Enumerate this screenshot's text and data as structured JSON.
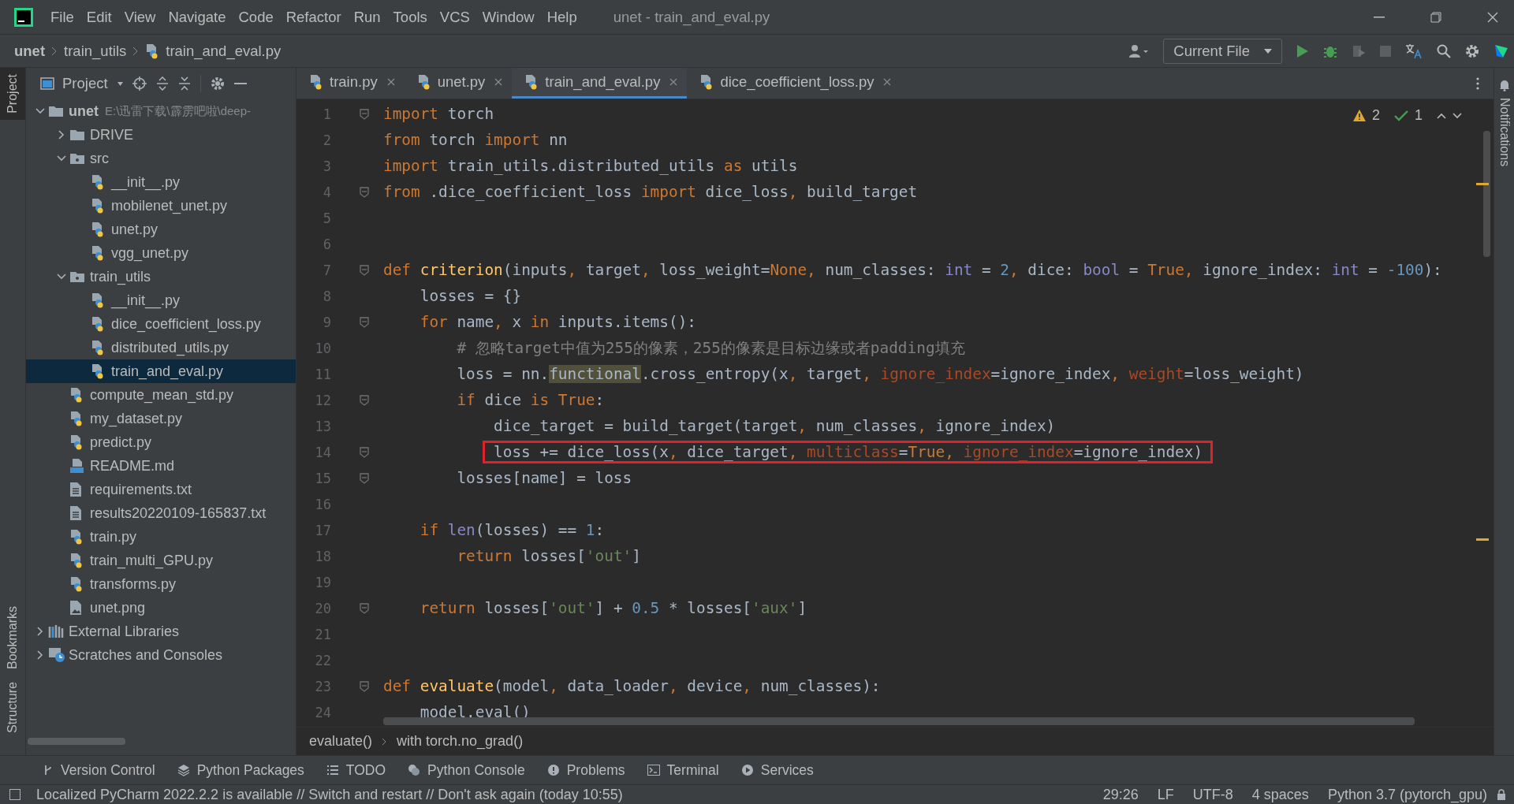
{
  "title_bar": {
    "menu": [
      "File",
      "Edit",
      "View",
      "Navigate",
      "Code",
      "Refactor",
      "Run",
      "Tools",
      "VCS",
      "Window",
      "Help"
    ],
    "title": "unet - train_and_eval.py"
  },
  "navigation_bar": {
    "path": [
      "unet",
      "train_utils",
      "train_and_eval.py"
    ],
    "run_config": "Current File"
  },
  "left_stripe": [
    {
      "label": "Project",
      "selected": true
    },
    {
      "label": "Bookmarks",
      "selected": false
    },
    {
      "label": "Structure",
      "selected": false
    }
  ],
  "project_panel": {
    "title": "Project",
    "tree": [
      {
        "name": "unet",
        "kind": "folder",
        "expanded": true,
        "selected": false,
        "path": "E:\\迅雷下载\\霹雳吧啦\\deep-",
        "children": [
          {
            "name": "DRIVE",
            "kind": "folder",
            "expanded": false,
            "selected": false
          },
          {
            "name": "src",
            "kind": "package",
            "expanded": true,
            "selected": false,
            "children": [
              {
                "name": "__init__.py",
                "kind": "python",
                "selected": false
              },
              {
                "name": "mobilenet_unet.py",
                "kind": "python",
                "selected": false
              },
              {
                "name": "unet.py",
                "kind": "python",
                "selected": false
              },
              {
                "name": "vgg_unet.py",
                "kind": "python",
                "selected": false
              }
            ]
          },
          {
            "name": "train_utils",
            "kind": "package",
            "expanded": true,
            "selected": false,
            "children": [
              {
                "name": "__init__.py",
                "kind": "python",
                "selected": false
              },
              {
                "name": "dice_coefficient_loss.py",
                "kind": "python",
                "selected": false
              },
              {
                "name": "distributed_utils.py",
                "kind": "python",
                "selected": false
              },
              {
                "name": "train_and_eval.py",
                "kind": "python",
                "selected": true
              }
            ]
          },
          {
            "name": "compute_mean_std.py",
            "kind": "python",
            "selected": false
          },
          {
            "name": "my_dataset.py",
            "kind": "python",
            "selected": false
          },
          {
            "name": "predict.py",
            "kind": "python",
            "selected": false
          },
          {
            "name": "README.md",
            "kind": "markdown",
            "selected": false
          },
          {
            "name": "requirements.txt",
            "kind": "text",
            "selected": false
          },
          {
            "name": "results20220109-165837.txt",
            "kind": "text",
            "selected": false
          },
          {
            "name": "train.py",
            "kind": "python",
            "selected": false
          },
          {
            "name": "train_multi_GPU.py",
            "kind": "python",
            "selected": false
          },
          {
            "name": "transforms.py",
            "kind": "python",
            "selected": false
          },
          {
            "name": "unet.png",
            "kind": "image",
            "selected": false
          }
        ]
      },
      {
        "name": "External Libraries",
        "kind": "library",
        "expanded": false,
        "selected": false
      },
      {
        "name": "Scratches and Consoles",
        "kind": "scratches",
        "expanded": false,
        "selected": false
      }
    ]
  },
  "editor": {
    "tabs": [
      {
        "label": "train.py",
        "selected": false
      },
      {
        "label": "unet.py",
        "selected": false
      },
      {
        "label": "train_and_eval.py",
        "selected": true
      },
      {
        "label": "dice_coefficient_loss.py",
        "selected": false
      }
    ],
    "inspections": {
      "warnings": "2",
      "weak_warnings": "1"
    },
    "lines": [
      {
        "number": "1",
        "fold": true,
        "boxed": false,
        "tokens": [
          {
            "kind": "keyword",
            "text": "import"
          },
          {
            "kind": "plain",
            "text": " torch"
          }
        ]
      },
      {
        "number": "2",
        "fold": false,
        "boxed": false,
        "tokens": [
          {
            "kind": "keyword",
            "text": "from"
          },
          {
            "kind": "plain",
            "text": " torch "
          },
          {
            "kind": "keyword",
            "text": "import"
          },
          {
            "kind": "plain",
            "text": " nn"
          }
        ]
      },
      {
        "number": "3",
        "fold": false,
        "boxed": false,
        "tokens": [
          {
            "kind": "keyword",
            "text": "import"
          },
          {
            "kind": "plain",
            "text": " train_utils.distributed_utils "
          },
          {
            "kind": "keyword",
            "text": "as"
          },
          {
            "kind": "plain",
            "text": " utils"
          }
        ]
      },
      {
        "number": "4",
        "fold": true,
        "boxed": false,
        "tokens": [
          {
            "kind": "keyword",
            "text": "from"
          },
          {
            "kind": "plain",
            "text": " .dice_coefficient_loss "
          },
          {
            "kind": "keyword",
            "text": "import"
          },
          {
            "kind": "plain",
            "text": " dice_loss"
          },
          {
            "kind": "punct",
            "text": ","
          },
          {
            "kind": "plain",
            "text": " build_target"
          }
        ]
      },
      {
        "number": "5",
        "fold": false
      },
      {
        "number": "6",
        "fold": false
      },
      {
        "number": "7",
        "fold": true,
        "boxed": false,
        "tokens": [
          {
            "kind": "keyword",
            "text": "def"
          },
          {
            "kind": "function",
            "text": " criterion"
          },
          {
            "kind": "plain",
            "text": "(inputs"
          },
          {
            "kind": "punct",
            "text": ","
          },
          {
            "kind": "plain",
            "text": " target"
          },
          {
            "kind": "punct",
            "text": ","
          },
          {
            "kind": "plain",
            "text": " loss_weight="
          },
          {
            "kind": "keyword",
            "text": "None"
          },
          {
            "kind": "punct",
            "text": ","
          },
          {
            "kind": "plain",
            "text": " num_classes: "
          },
          {
            "kind": "builtin",
            "text": "int"
          },
          {
            "kind": "plain",
            "text": " = "
          },
          {
            "kind": "number",
            "text": "2"
          },
          {
            "kind": "punct",
            "text": ","
          },
          {
            "kind": "plain",
            "text": " dice: "
          },
          {
            "kind": "builtin",
            "text": "bool"
          },
          {
            "kind": "plain",
            "text": " = "
          },
          {
            "kind": "keyword",
            "text": "True"
          },
          {
            "kind": "punct",
            "text": ","
          },
          {
            "kind": "plain",
            "text": " ignore_index: "
          },
          {
            "kind": "builtin",
            "text": "int"
          },
          {
            "kind": "plain",
            "text": " = "
          },
          {
            "kind": "number",
            "text": "-100"
          },
          {
            "kind": "plain",
            "text": "):"
          }
        ]
      },
      {
        "number": "8",
        "fold": false,
        "boxed": false,
        "tokens": [
          {
            "kind": "plain",
            "text": "    losses = {}"
          }
        ]
      },
      {
        "number": "9",
        "fold": true,
        "boxed": false,
        "tokens": [
          {
            "kind": "keyword",
            "text": "    for"
          },
          {
            "kind": "plain",
            "text": " name"
          },
          {
            "kind": "punct",
            "text": ","
          },
          {
            "kind": "plain",
            "text": " x "
          },
          {
            "kind": "keyword",
            "text": "in"
          },
          {
            "kind": "plain",
            "text": " inputs.items():"
          }
        ]
      },
      {
        "number": "10",
        "fold": false,
        "boxed": false,
        "tokens": [
          {
            "kind": "comment",
            "text": "        # 忽略target中值为255的像素，255的像素是目标边缘或者padding填充"
          }
        ]
      },
      {
        "number": "11",
        "fold": false,
        "boxed": false,
        "tokens": [
          {
            "kind": "plain",
            "text": "        loss = nn."
          },
          {
            "kind": "highlight",
            "text": "functional"
          },
          {
            "kind": "plain",
            "text": ".cross_entropy(x"
          },
          {
            "kind": "punct",
            "text": ","
          },
          {
            "kind": "plain",
            "text": " target"
          },
          {
            "kind": "punct",
            "text": ","
          },
          {
            "kind": "named_arg",
            "text": " ignore_index"
          },
          {
            "kind": "plain",
            "text": "=ignore_index"
          },
          {
            "kind": "punct",
            "text": ","
          },
          {
            "kind": "named_arg",
            "text": " weight"
          },
          {
            "kind": "plain",
            "text": "=loss_weight)"
          }
        ]
      },
      {
        "number": "12",
        "fold": true,
        "boxed": false,
        "tokens": [
          {
            "kind": "keyword",
            "text": "        if"
          },
          {
            "kind": "plain",
            "text": " dice "
          },
          {
            "kind": "keyword",
            "text": "is True"
          },
          {
            "kind": "plain",
            "text": ":"
          }
        ]
      },
      {
        "number": "13",
        "fold": false,
        "boxed": false,
        "tokens": [
          {
            "kind": "plain",
            "text": "            dice_target = build_target(target"
          },
          {
            "kind": "punct",
            "text": ","
          },
          {
            "kind": "plain",
            "text": " num_classes"
          },
          {
            "kind": "punct",
            "text": ","
          },
          {
            "kind": "plain",
            "text": " ignore_index)"
          }
        ]
      },
      {
        "number": "14",
        "fold": true,
        "boxed": true,
        "tokens": [
          {
            "kind": "plain",
            "text": "            loss += dice_loss(x"
          },
          {
            "kind": "punct",
            "text": ","
          },
          {
            "kind": "plain",
            "text": " dice_target"
          },
          {
            "kind": "punct",
            "text": ","
          },
          {
            "kind": "named_arg",
            "text": " multiclass"
          },
          {
            "kind": "plain",
            "text": "="
          },
          {
            "kind": "keyword",
            "text": "True"
          },
          {
            "kind": "punct",
            "text": ","
          },
          {
            "kind": "named_arg",
            "text": " ignore_index"
          },
          {
            "kind": "plain",
            "text": "=ignore_index)"
          }
        ]
      },
      {
        "number": "15",
        "fold": true,
        "boxed": false,
        "tokens": [
          {
            "kind": "plain",
            "text": "        losses[name] = loss"
          }
        ]
      },
      {
        "number": "16",
        "fold": false
      },
      {
        "number": "17",
        "fold": false,
        "boxed": false,
        "tokens": [
          {
            "kind": "keyword",
            "text": "    if"
          },
          {
            "kind": "builtin",
            "text": " len"
          },
          {
            "kind": "plain",
            "text": "(losses) == "
          },
          {
            "kind": "number",
            "text": "1"
          },
          {
            "kind": "plain",
            "text": ":"
          }
        ]
      },
      {
        "number": "18",
        "fold": false,
        "boxed": false,
        "tokens": [
          {
            "kind": "keyword",
            "text": "        return"
          },
          {
            "kind": "plain",
            "text": " losses["
          },
          {
            "kind": "string",
            "text": "'out'"
          },
          {
            "kind": "plain",
            "text": "]"
          }
        ]
      },
      {
        "number": "19",
        "fold": false
      },
      {
        "number": "20",
        "fold": true,
        "boxed": false,
        "tokens": [
          {
            "kind": "keyword",
            "text": "    return"
          },
          {
            "kind": "plain",
            "text": " losses["
          },
          {
            "kind": "string",
            "text": "'out'"
          },
          {
            "kind": "plain",
            "text": "] + "
          },
          {
            "kind": "number",
            "text": "0.5"
          },
          {
            "kind": "plain",
            "text": " * losses["
          },
          {
            "kind": "string",
            "text": "'aux'"
          },
          {
            "kind": "plain",
            "text": "]"
          }
        ]
      },
      {
        "number": "21",
        "fold": false
      },
      {
        "number": "22",
        "fold": false
      },
      {
        "number": "23",
        "fold": true,
        "boxed": false,
        "tokens": [
          {
            "kind": "keyword",
            "text": "def"
          },
          {
            "kind": "function",
            "text": " evaluate"
          },
          {
            "kind": "plain",
            "text": "(model"
          },
          {
            "kind": "punct",
            "text": ","
          },
          {
            "kind": "plain",
            "text": " data_loader"
          },
          {
            "kind": "punct",
            "text": ","
          },
          {
            "kind": "plain",
            "text": " device"
          },
          {
            "kind": "punct",
            "text": ","
          },
          {
            "kind": "plain",
            "text": " num_classes):"
          }
        ]
      },
      {
        "number": "24",
        "fold": false,
        "boxed": false,
        "tokens": [
          {
            "kind": "plain",
            "text": "    model.eval()"
          }
        ]
      }
    ],
    "breadcrumbs": [
      "evaluate()",
      "with torch.no_grad()"
    ]
  },
  "right_stripe": {
    "label": "Notifications"
  },
  "tool_windows": [
    {
      "label": "Version Control",
      "kind": "vcs"
    },
    {
      "label": "Python Packages",
      "kind": "packages"
    },
    {
      "label": "TODO",
      "kind": "todo"
    },
    {
      "label": "Python Console",
      "kind": "console"
    },
    {
      "label": "Problems",
      "kind": "problems"
    },
    {
      "label": "Terminal",
      "kind": "terminal"
    },
    {
      "label": "Services",
      "kind": "services"
    }
  ],
  "status_bar": {
    "message": "Localized PyCharm 2022.2.2 is available // Switch and restart // Don't ask again (today 10:55)",
    "items": [
      "29:26",
      "LF",
      "UTF-8",
      "4 spaces",
      "Python 3.7 (pytorch_gpu)"
    ]
  }
}
